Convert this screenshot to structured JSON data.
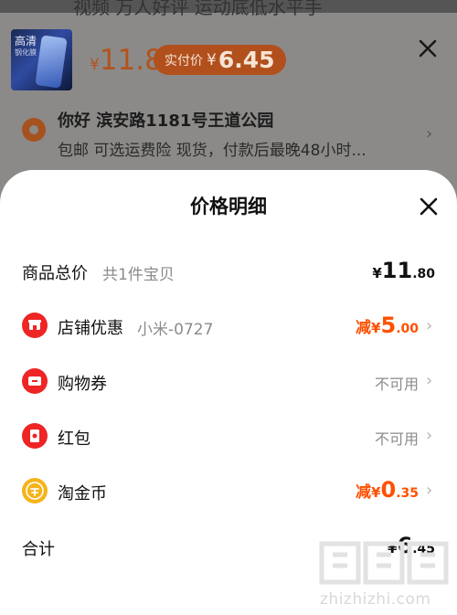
{
  "background": {
    "top_cut_text": "视频  万人好评 运动底低水平手",
    "product_thumb_line1": "高清",
    "product_thumb_line2": "钢化膜",
    "price_currency": "¥",
    "price_value": "11.8",
    "paid_label": "实付价",
    "paid_currency": "¥",
    "paid_value": "6.45",
    "address_name": "你好 滨安路1181号王道公园",
    "address_sub": "包邮 可选运费险 现货，付款后最晚48小时..."
  },
  "sheet": {
    "title": "价格明细",
    "rows": [
      {
        "label": "商品总价",
        "sub": "共1件宝贝",
        "currency": "¥",
        "int": "11",
        "dec": ".80"
      },
      {
        "label": "店铺优惠",
        "sub": "小米-0727",
        "prefix": "减",
        "currency": "¥",
        "int": "5",
        "dec": ".00",
        "icon": "store-icon"
      },
      {
        "label": "购物券",
        "status": "不可用",
        "icon": "ticket-icon"
      },
      {
        "label": "红包",
        "status": "不可用",
        "icon": "red-envelope-icon"
      },
      {
        "label": "淘金币",
        "prefix": "减",
        "currency": "¥",
        "int": "0",
        "dec": ".35",
        "icon": "coin-icon"
      }
    ],
    "total": {
      "label": "合计",
      "currency": "¥",
      "int": "6",
      "dec": ".45"
    }
  },
  "watermark": {
    "text": "zhizhizhi.com",
    "logo": "值"
  },
  "colors": {
    "accent": "#ff5000",
    "icon_red": "#ef2424",
    "coin_gold": "#f6b31a",
    "muted": "#8b8b8b"
  }
}
